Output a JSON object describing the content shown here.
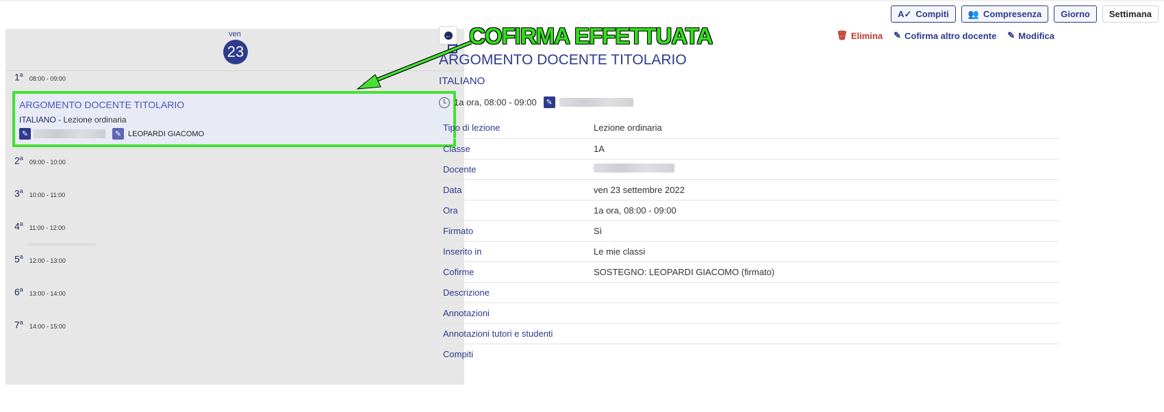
{
  "toolbar": {
    "compiti": "Compiti",
    "compresenza": "Compresenza",
    "giorno": "Giorno",
    "settimana": "Settimana"
  },
  "day": {
    "weekday": "ven",
    "number": "23"
  },
  "slots": [
    {
      "num": "1",
      "sup": "a",
      "time": "08:00 - 09:00"
    },
    {
      "num": "2",
      "sup": "a",
      "time": "09:00 - 10:00"
    },
    {
      "num": "3",
      "sup": "a",
      "time": "10:00 - 11:00"
    },
    {
      "num": "4",
      "sup": "a",
      "time": "11:00 - 12:00"
    },
    {
      "num": "5",
      "sup": "a",
      "time": "12:00 - 13:00"
    },
    {
      "num": "6",
      "sup": "a",
      "time": "13:00 - 14:00"
    },
    {
      "num": "7",
      "sup": "a",
      "time": "14:00 - 15:00"
    }
  ],
  "lesson_card": {
    "title": "ARGOMENTO DOCENTE TITOLARIO",
    "subject": "ITALIANO",
    "type": " - Lezione ordinaria",
    "cosign_teacher": "LEOPARDI GIACOMO"
  },
  "annotation": "COFIRMA EFFETTUATA",
  "actions": {
    "elimina": "Elimina",
    "cofirma": "Cofirma altro docente",
    "modifica": "Modifica"
  },
  "detail": {
    "title": "ARGOMENTO DOCENTE TITOLARIO",
    "subject": "ITALIANO",
    "time": "1a ora, 08:00 - 09:00",
    "rows": [
      {
        "label": "Tipo di lezione",
        "value": "Lezione ordinaria"
      },
      {
        "label": "Classe",
        "value": "1A"
      },
      {
        "label": "Docente",
        "value": ""
      },
      {
        "label": "Data",
        "value": "ven 23 settembre 2022"
      },
      {
        "label": "Ora",
        "value": "1a ora, 08:00 - 09:00"
      },
      {
        "label": "Firmato",
        "value": "Sì"
      },
      {
        "label": "Inserito in",
        "value": "Le mie classi"
      },
      {
        "label": "Cofirme",
        "value": "SOSTEGNO: LEOPARDI GIACOMO (firmato)"
      },
      {
        "label": "Descrizione",
        "value": ""
      },
      {
        "label": "Annotazioni",
        "value": ""
      },
      {
        "label": "Annotazioni tutori e studenti",
        "value": ""
      },
      {
        "label": "Compiti",
        "value": ""
      }
    ]
  },
  "colors": {
    "brand": "#2e3a8c",
    "highlight": "#44e033",
    "danger": "#c0392b"
  }
}
